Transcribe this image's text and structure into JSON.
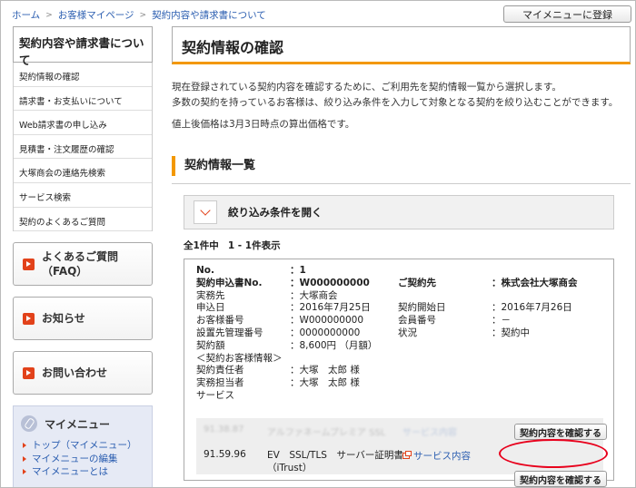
{
  "breadcrumb": [
    "ホーム",
    "お客様マイページ",
    "契約内容や請求書について"
  ],
  "header": {
    "mymenu_button": "マイメニューに登録"
  },
  "sidebar": {
    "title": "契約内容や請求書について",
    "items": [
      "契約情報の確認",
      "請求書・お支払いについて",
      "Web請求書の申し込み",
      "見積書・注文履歴の確認",
      "大塚商会の連絡先検索",
      "サービス検索",
      "契約のよくあるご質問"
    ],
    "faq_line1": "よくあるご質問",
    "faq_line2": "（FAQ）",
    "news": "お知らせ",
    "contact": "お問い合わせ",
    "mymenu": {
      "title": "マイメニュー",
      "links": [
        "トップ（マイメニュー）",
        "マイメニューの編集",
        "マイメニューとは"
      ]
    }
  },
  "main": {
    "title": "契約情報の確認",
    "intro_line1": "現在登録されている契約内容を確認するために、ご利用先を契約情報一覧から選択します。",
    "intro_line2": "多数の契約を持っているお客様は、絞り込み条件を入力して対象となる契約を絞り込むことができます。",
    "price_note": "値上後価格は3月3日時点の算出価格です。",
    "list_title": "契約情報一覧",
    "filter_label": "絞り込み条件を開く",
    "count_total": "全1件中",
    "count_range": "1 - 1件表示"
  },
  "contract": {
    "no_label": "No.",
    "no_value": "：1",
    "app_no_label": "契約申込書No.",
    "app_no_value": "：W000000000",
    "customer_label": "ご契約先",
    "customer_value": "：株式会社大塚商会",
    "site_label": "実務先",
    "site_value": "：大塚商会",
    "apply_date_label": "申込日",
    "apply_date_value": "：2016年7月25日",
    "start_date_label": "契約開始日",
    "start_date_value": "：2016年7月26日",
    "cust_no_label": "お客様番号",
    "cust_no_value": "：W000000000",
    "member_no_label": "会員番号",
    "member_no_value": "：－",
    "admin_no_label": "設置先管理番号",
    "admin_no_value": "：0000000000",
    "status_label": "状況",
    "status_value": "：契約中",
    "amount_label": "契約額",
    "amount_value": "：8,600円 （月額）",
    "info_header": "＜契約お客様情報＞",
    "resp_label": "契約責任者",
    "resp_value": "：大塚　太郎 様",
    "staff_label": "実務担当者",
    "staff_value": "：大塚　太郎 様",
    "service_label": "サービス"
  },
  "services": [
    {
      "code": "91.38.87",
      "name": "アルファネームプレミア SSL",
      "link": "サービス内容",
      "button": "契約内容を確認する"
    },
    {
      "code": "91.59.96",
      "name_line1": "EV　SSL/TLS　サーバー証明書",
      "name_line2": "（iTrust）",
      "link": "サービス内容",
      "button": "契約内容を確認する"
    }
  ]
}
